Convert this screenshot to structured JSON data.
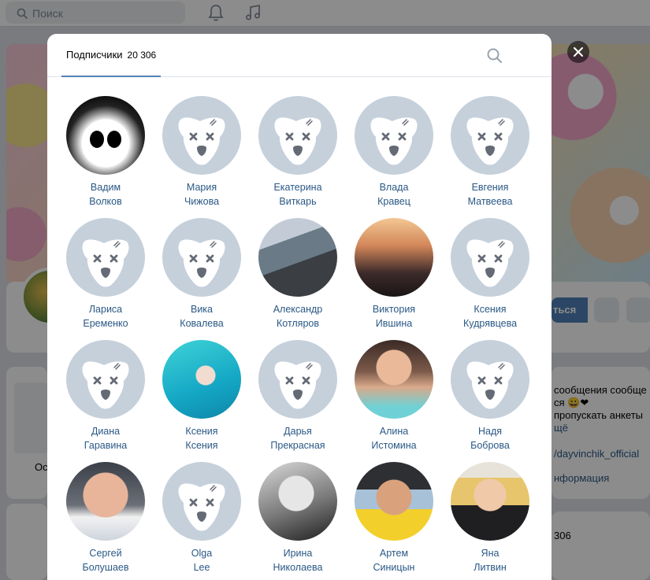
{
  "background": {
    "search_placeholder": "Поиск",
    "write_button": "ться",
    "post_text_line1": "сообщения сообще",
    "post_text_line2": "ся 😀❤",
    "post_text_line3": "пропускать анкеты",
    "post_text_line4": "щё",
    "link_text": "/dayvinchik_official",
    "info_text": "нформация",
    "members_count": "306",
    "left_label": "Ос"
  },
  "modal": {
    "tab_label": "Подписчики",
    "tab_count": "20 306",
    "followers": [
      {
        "first": "Вадим",
        "last": "Волков",
        "avatar": "panda"
      },
      {
        "first": "Мария",
        "last": "Чижова",
        "avatar": "default"
      },
      {
        "first": "Екатерина",
        "last": "Виткарь",
        "avatar": "default"
      },
      {
        "first": "Влада",
        "last": "Кравец",
        "avatar": "default"
      },
      {
        "first": "Евгения",
        "last": "Матвеева",
        "avatar": "default"
      },
      {
        "first": "Лариса",
        "last": "Еременко",
        "avatar": "default"
      },
      {
        "first": "Вика",
        "last": "Ковалева",
        "avatar": "default"
      },
      {
        "first": "Александр",
        "last": "Котляров",
        "avatar": "photo"
      },
      {
        "first": "Виктория",
        "last": "Ившина",
        "avatar": "photo"
      },
      {
        "first": "Ксения",
        "last": "Кудрявцева",
        "avatar": "default"
      },
      {
        "first": "Диана",
        "last": "Гаравина",
        "avatar": "default"
      },
      {
        "first": "Ксения",
        "last": "Ксения",
        "avatar": "photo"
      },
      {
        "first": "Дарья",
        "last": "Прекрасная",
        "avatar": "default"
      },
      {
        "first": "Алина",
        "last": "Истомина",
        "avatar": "photo"
      },
      {
        "first": "Надя",
        "last": "Боброва",
        "avatar": "default"
      },
      {
        "first": "Сергей",
        "last": "Болушаев",
        "avatar": "photo"
      },
      {
        "first": "Olga",
        "last": "Lee",
        "avatar": "default"
      },
      {
        "first": "Ирина",
        "last": "Николаева",
        "avatar": "photo"
      },
      {
        "first": "Артем",
        "last": "Синицын",
        "avatar": "photo"
      },
      {
        "first": "Яна",
        "last": "Литвин",
        "avatar": "photo"
      }
    ]
  },
  "icons": {
    "search": "search-icon",
    "bell": "bell-icon",
    "music": "music-icon",
    "close": "close-icon",
    "default_avatar": "vk-dog-icon"
  }
}
